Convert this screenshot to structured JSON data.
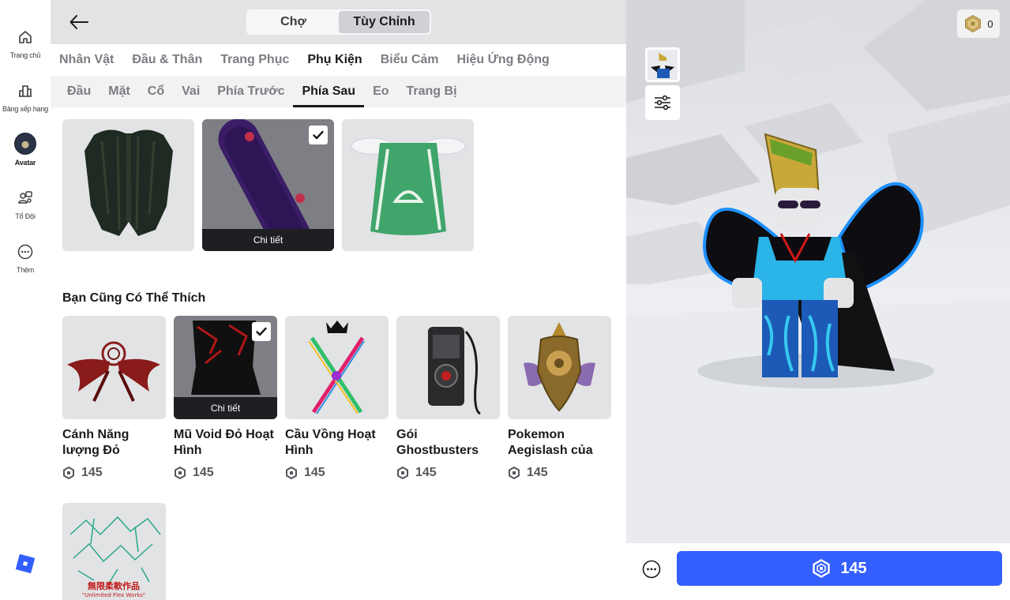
{
  "nav": {
    "items": [
      {
        "label": "Trang chủ",
        "icon": "home-icon"
      },
      {
        "label": "Bảng xếp hạng",
        "icon": "leaderboard-icon"
      },
      {
        "label": "Avatar",
        "icon": "avatar-icon"
      },
      {
        "label": "Tổ Đội",
        "icon": "party-icon"
      },
      {
        "label": "Thêm",
        "icon": "more-icon"
      }
    ],
    "active": "Avatar"
  },
  "header": {
    "segments": [
      "Chợ",
      "Tùy Chỉnh"
    ],
    "selected_segment": "Tùy Chỉnh"
  },
  "categories": {
    "items": [
      "Nhân Vật",
      "Đầu & Thân",
      "Trang Phục",
      "Phụ Kiện",
      "Biểu Cảm",
      "Hiệu Ứng Động"
    ],
    "selected": "Phụ Kiện"
  },
  "subcategories": {
    "items": [
      "Đầu",
      "Mặt",
      "Cổ",
      "Vai",
      "Phía Trước",
      "Phía Sau",
      "Eo",
      "Trang Bị"
    ],
    "selected": "Phía Sau"
  },
  "inventory": {
    "items": [
      {
        "name": "black-wings-item",
        "equipped": false
      },
      {
        "name": "skateboard-item",
        "equipped": true,
        "detail_label": "Chi tiết"
      },
      {
        "name": "green-cape-item",
        "equipped": false
      }
    ]
  },
  "recommendations": {
    "title": "Bạn Cũng Có Thể Thích",
    "items": [
      {
        "name": "Cánh Năng lượng Đỏ",
        "price": "145",
        "equipped": false
      },
      {
        "name": "Mũ Void Đỏ Hoạt Hình",
        "price": "145",
        "equipped": true,
        "detail_label": "Chi tiết"
      },
      {
        "name": "Cầu Vồng Hoạt Hình",
        "price": "145",
        "equipped": false
      },
      {
        "name": "Gói Ghostbusters",
        "price": "145",
        "equipped": false
      },
      {
        "name": "Pokemon Aegislash của",
        "price": "145",
        "equipped": false
      },
      {
        "name": "",
        "price": "",
        "equipped": false
      }
    ],
    "last_thumb_text": [
      "無限柔軟作品",
      "\"Unlimited Flex Works\""
    ]
  },
  "preview": {
    "robux_balance": "0",
    "buy_price": "145"
  },
  "colors": {
    "accent": "#335fff",
    "rail_bg": "#ffffff",
    "tile_bg": "#e2e3e5"
  }
}
